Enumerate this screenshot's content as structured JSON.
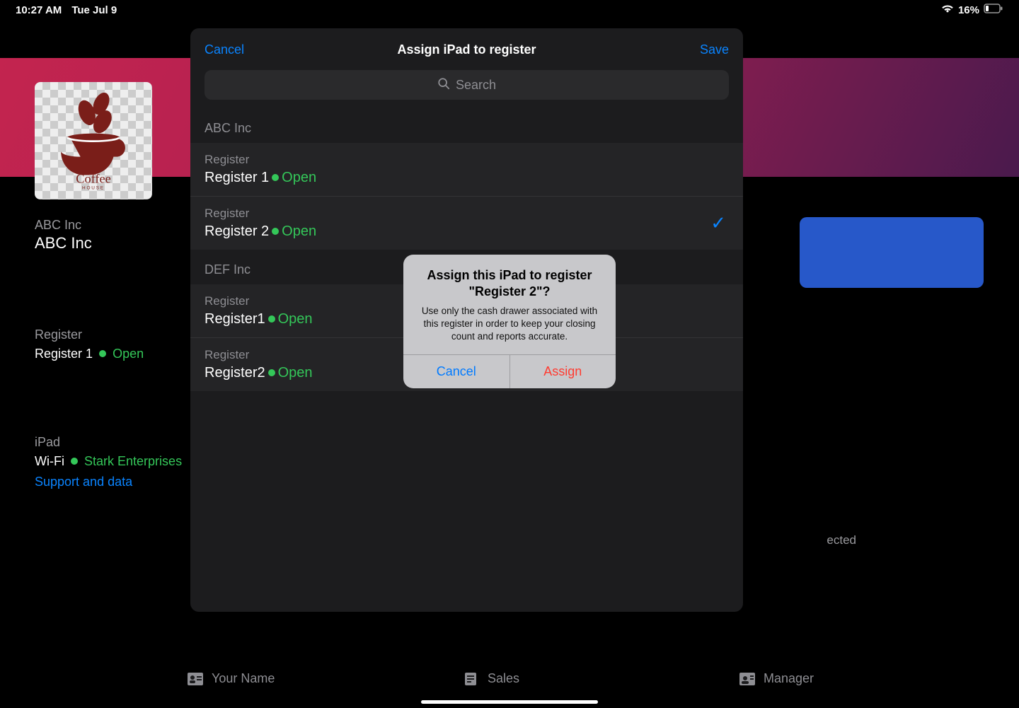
{
  "status_bar": {
    "time": "10:27 AM",
    "date": "Tue Jul 9",
    "battery_pct": "16%"
  },
  "background": {
    "org_label": "ABC Inc",
    "org_name": "ABC Inc",
    "register_label": "Register",
    "register_name": "Register 1",
    "register_status": "Open",
    "ipad_label": "iPad",
    "wifi_label": "Wi-Fi",
    "wifi_name": "Stark Enterprises",
    "support_link": "Support and data",
    "detected_fragment": "ected",
    "bottom": {
      "name_placeholder": "Your Name",
      "mode": "Sales",
      "role": "Manager"
    }
  },
  "modal": {
    "cancel": "Cancel",
    "title": "Assign iPad to register",
    "save": "Save",
    "search_placeholder": "Search",
    "sections": [
      {
        "header": "ABC Inc",
        "rows": [
          {
            "eyebrow": "Register",
            "name": "Register 1",
            "status": "Open",
            "selected": false
          },
          {
            "eyebrow": "Register",
            "name": "Register 2",
            "status": "Open",
            "selected": true
          }
        ]
      },
      {
        "header": "DEF Inc",
        "rows": [
          {
            "eyebrow": "Register",
            "name": "Register1",
            "status": "Open",
            "selected": false
          },
          {
            "eyebrow": "Register",
            "name": "Register2",
            "status": "Open",
            "selected": false
          }
        ]
      }
    ]
  },
  "alert": {
    "title": "Assign this iPad to register \"Register 2\"?",
    "message": "Use only the cash drawer associated with this register in order to keep your closing count and reports accurate.",
    "cancel": "Cancel",
    "confirm": "Assign"
  }
}
